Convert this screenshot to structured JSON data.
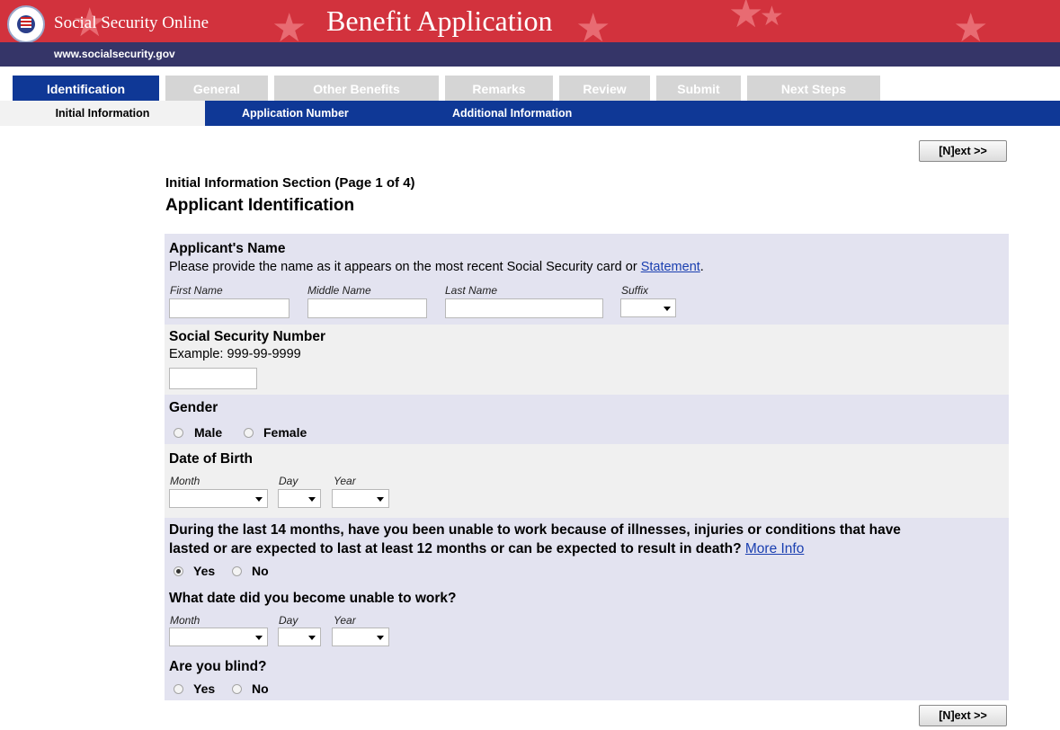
{
  "header": {
    "site_title": "Social Security Online",
    "app_title": "Benefit Application",
    "url": "www.socialsecurity.gov",
    "seal_icon": "ssa-seal-icon",
    "colors": {
      "red": "#d2323d",
      "navy": "#353568",
      "blue": "#0f3896"
    }
  },
  "tabs": [
    {
      "label": "Identification",
      "active": true
    },
    {
      "label": "General"
    },
    {
      "label": "Other Benefits"
    },
    {
      "label": "Remarks"
    },
    {
      "label": "Review"
    },
    {
      "label": "Submit"
    },
    {
      "label": "Next Steps"
    }
  ],
  "subnav": [
    {
      "label": "Initial Information",
      "active": true
    },
    {
      "label": "Application Number"
    },
    {
      "label": "Additional Information"
    }
  ],
  "next_button": "[N]ext >>",
  "section_title": "Initial Information Section (Page 1 of 4)",
  "page_title": "Applicant Identification",
  "name": {
    "heading": "Applicant's Name",
    "instruction": "Please provide the name as it appears on the most recent Social Security card or ",
    "link": "Statement",
    "instruction_end": ".",
    "first": "First Name",
    "middle": "Middle Name",
    "last": "Last Name",
    "suffix": "Suffix"
  },
  "ssn": {
    "heading": "Social Security Number",
    "example": "Example: 999-99-9999"
  },
  "gender": {
    "heading": "Gender",
    "male": "Male",
    "female": "Female"
  },
  "dob": {
    "heading": "Date of Birth",
    "month": "Month",
    "day": "Day",
    "year": "Year"
  },
  "unable": {
    "question_line1": "During the last 14 months, have you been unable to work because of illnesses, injuries or conditions that have",
    "question_line2": "lasted or are expected to last at least 12 months or can be expected to result in death?",
    "more_info": "More Info",
    "yes": "Yes",
    "no": "No",
    "selected": "Yes"
  },
  "unable_date": {
    "heading": "What date did you become unable to work?",
    "month": "Month",
    "day": "Day",
    "year": "Year"
  },
  "blind": {
    "heading": "Are you blind?",
    "yes": "Yes",
    "no": "No"
  }
}
